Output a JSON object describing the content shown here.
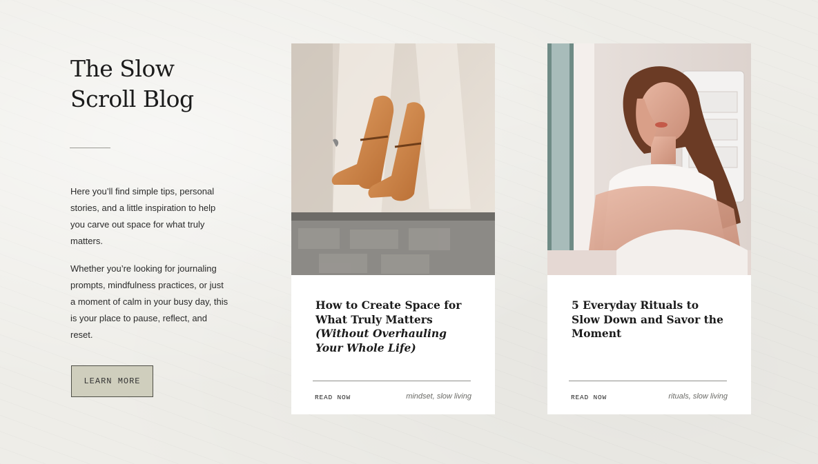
{
  "intro": {
    "title_line1": "The Slow",
    "title_line2": "Scroll Blog",
    "paragraph1": "Here you’ll find simple tips, personal stories, and a little inspiration to help you carve out space for what truly matters.",
    "paragraph2": "Whether you’re looking for journaling prompts, mindfulness practices, or just a moment of calm in your busy day, this is your place to pause, reflect, and reset.",
    "button_label": "LEARN MORE"
  },
  "posts": [
    {
      "title_main": "How to Create Space for What Truly Matters ",
      "title_italic": "(Without Overhauling Your Whole Life)",
      "read_label": "READ NOW",
      "tag1": "mindset",
      "separator": ", ",
      "tag2": "slow living",
      "image": "orange-loafer-shoes-photo"
    },
    {
      "title_main": "5 Everyday Rituals to Slow Down and Savor the Moment",
      "title_italic": "",
      "read_label": "READ NOW",
      "tag1": "rituals",
      "separator": ", ",
      "tag2": "slow living",
      "image": "woman-with-braids-photo"
    }
  ],
  "colors": {
    "background": "#eeede8",
    "button_fill": "#cfcebd",
    "card": "#ffffff",
    "tag_text": "#6a6a66"
  }
}
